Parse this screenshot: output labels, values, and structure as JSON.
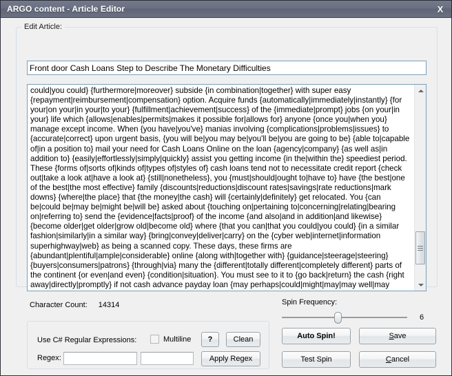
{
  "window": {
    "title": "ARGO content - Article Editor",
    "close_label": "X"
  },
  "groups": {
    "edit_article_caption": "Edit Article:"
  },
  "article": {
    "title_value": "Front door Cash Loans Step to Describe The Monetary Difficulties",
    "title_placeholder": "",
    "body_value": "could|you could} {furthermore|moreover} subside {in combination|together} with super easy {repayment|reimbursement|compensation} option. Acquire funds {automatically|immediately|instantly} {for your|on your|in your|to your} {fulfillment|achievement|success} of the {immediate|prompt} jobs {on your|in your} life which {allows|enables|permits|makes it possible for|allows for} anyone {once you|when you} manage except income. When {you have|you've} manias involving {complications|problems|issues} to {accurate|correct} upon urgent basis, {you will be|you may be|you'll be|you are going to be} {able to|capable of|in a position to} mail your need for Cash Loans Online on the loan {agency|company} {as well as|in addition to} {easily|effortlessly|simply|quickly} assist you getting income {in the|within the} speediest period. These {forms of|sorts of|kinds of|types of|styles of} cash loans tend not to necessitate credit report {check out|take a look at|have a look at} {still|nonetheless}, you {must|should|ought to|have to} have {the best|one of the best|the most effective} family {discounts|reductions|discount rates|savings|rate reductions|mark downs} {where|the place} that {the money|the cash} will {certainly|definitely} get relocated. You {can be|could be|may be|might be|will be} asked about {touching on|pertaining to|concerning|relating|bearing on|referring to} send the {evidence|facts|proof} of the income {and also|and in addition|and likewise} {become older|get older|grow old|become old} where {that you can|that you could|you could} {in a similar fashion|similarly|in a similar way} {bring|convey|deliver|carry} on the {cyber web|internet|information superhighway|web} as being a scanned copy. These days, these firms are {abundant|plentiful|ample|considerable} online {along with|together with} {guidance|steerage|steering} {buyers|consumers|patrons} {through|via} many the {different|totally different|completely different} parts of the continent {or even|and even} {condition|situation}. You must see to it to {go back|return} the cash {right away|directly|promptly} if not cash advance payday loan {may perhaps|could|might|may|may well|may possibly} {boost|increase|enhance} a worse head ache {on your|in your} case. You should select {among|between} {a few|several|a couple of|a number of} {choices|decisions|selections} very {carefully|cautiously} {to remain|to stay} {clear of|away from} more {responsibilities|duties|obligations} {in the future|sooner or later}.",
    "char_count_label": "Character Count:",
    "char_count_value": "14314"
  },
  "scrollbar": {
    "up_icon": "triangle-up-icon",
    "down_icon": "triangle-down-icon",
    "thumb_icon": "scrollbar-grip-icon"
  },
  "spin": {
    "label": "Spin Frequency:",
    "value": "6",
    "min": 1,
    "max": 12,
    "thumb_percent": 44
  },
  "regex": {
    "use_label": "Use C# Regular Expressions:",
    "multiline_label": "Multiline",
    "multiline_checked": false,
    "field_label": "Regex:",
    "input1_value": "",
    "input1_placeholder": "",
    "input2_value": "",
    "input2_placeholder": "",
    "help_label": "?",
    "clean_label": "Clean",
    "apply_label": "Apply Regex"
  },
  "actions": {
    "auto_spin_label": "Auto Spin!",
    "test_spin_label": "Test Spin",
    "save_accel": "S",
    "save_rest": "ave",
    "cancel_accel": "C",
    "cancel_rest": "ancel"
  },
  "colors": {
    "titlebar": "#6a7082",
    "client": "#f0f0f0",
    "field_border": "#7b9eb8",
    "text": "#000000"
  }
}
